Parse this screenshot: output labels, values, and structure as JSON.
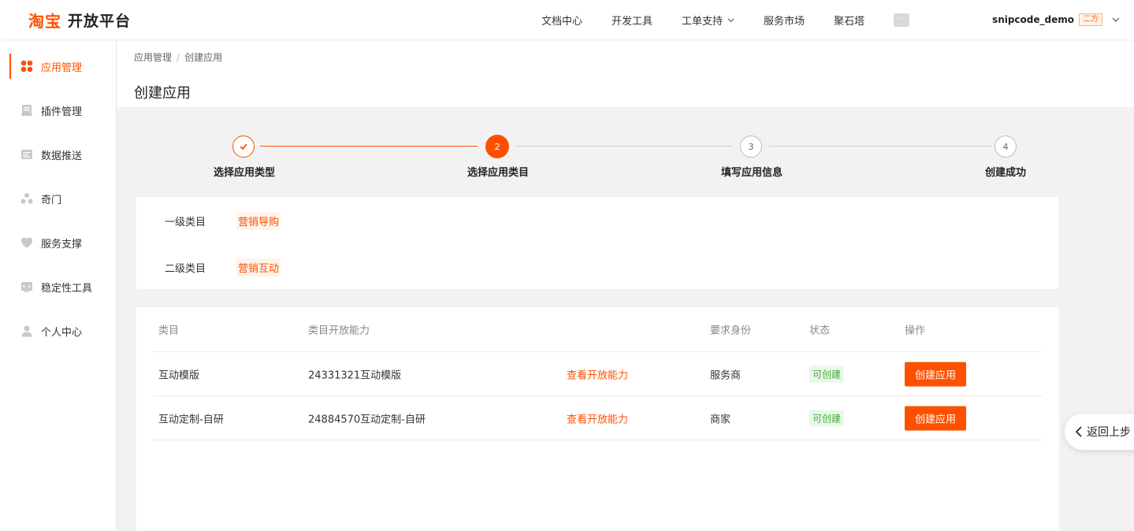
{
  "header": {
    "brand": "淘宝",
    "sub": "开放平台",
    "nav": [
      {
        "label": "文档中心"
      },
      {
        "label": "开发工具"
      },
      {
        "label": "工单支持",
        "dropdown": true
      },
      {
        "label": "服务市场"
      },
      {
        "label": "聚石塔"
      }
    ],
    "message_icon": "chat-bubble-icon",
    "user": {
      "name": "snipcode_demo",
      "badge": "二方"
    }
  },
  "sidebar": {
    "items": [
      {
        "label": "应用管理",
        "icon": "grid-icon",
        "active": true
      },
      {
        "label": "插件管理",
        "icon": "plugin-icon"
      },
      {
        "label": "数据推送",
        "icon": "data-push-icon"
      },
      {
        "label": "奇门",
        "icon": "qimen-icon"
      },
      {
        "label": "服务支撑",
        "icon": "heart-icon"
      },
      {
        "label": "稳定性工具",
        "icon": "code-tool-icon"
      },
      {
        "label": "个人中心",
        "icon": "user-icon"
      }
    ]
  },
  "breadcrumb": {
    "items": [
      "应用管理",
      "创建应用"
    ],
    "separator": "/"
  },
  "page_title": "创建应用",
  "steps": [
    {
      "num": "1",
      "label": "选择应用类型",
      "state": "done"
    },
    {
      "num": "2",
      "label": "选择应用类目",
      "state": "current"
    },
    {
      "num": "3",
      "label": "填写应用信息",
      "state": "todo"
    },
    {
      "num": "4",
      "label": "创建成功",
      "state": "todo"
    }
  ],
  "category": {
    "level1_label": "一级类目",
    "level1_value": "营销导购",
    "level2_label": "二级类目",
    "level2_value": "营销互动"
  },
  "table": {
    "headers": [
      "类目",
      "类目开放能力",
      "",
      "要求身份",
      "状态",
      "操作"
    ],
    "rows": [
      {
        "category": "互动模版",
        "capability": "24331321互动模版",
        "link": "查看开放能力",
        "identity": "服务商",
        "status": "可创建",
        "action": "创建应用"
      },
      {
        "category": "互动定制-自研",
        "capability": "24884570互动定制-自研",
        "link": "查看开放能力",
        "identity": "商家",
        "status": "可创建",
        "action": "创建应用"
      }
    ]
  },
  "back_button": "返回上步",
  "colors": {
    "accent": "#ff5000",
    "success": "#3cb034"
  }
}
